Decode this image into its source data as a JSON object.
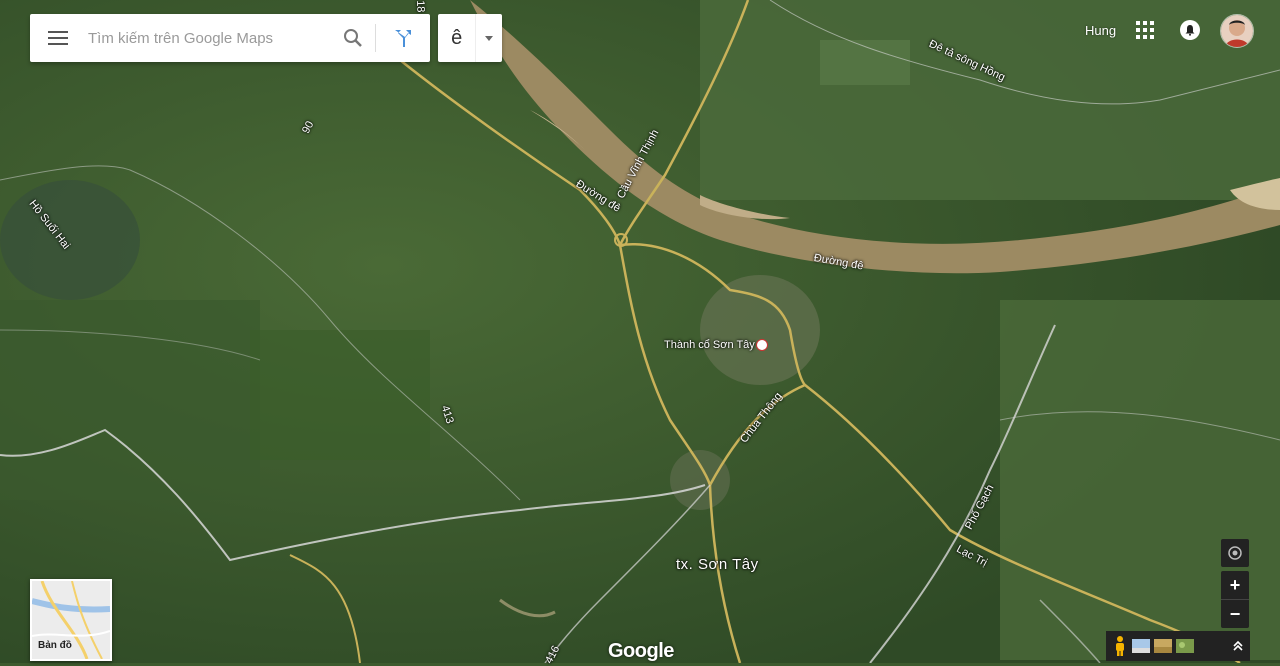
{
  "search": {
    "placeholder": "Tìm kiếm trên Google Maps"
  },
  "ime": {
    "char": "ê"
  },
  "user": {
    "name": "Hung"
  },
  "map": {
    "type": "satellite",
    "labels": {
      "city": "tx. Sơn Tây",
      "citadel": "Thành cổ Sơn Tây",
      "bridge": "Cầu Vĩnh Thịnh",
      "dike_road_1": "Đường đê",
      "dike_road_2": "Đường đê",
      "dike_red_river": "Đê tả sông Hồng",
      "lake": "Hồ Suối Hai",
      "chua_thong": "Chùa Thông",
      "pho_gach": "Phố Gạch",
      "lac_tri": "Lạc Trị",
      "route_90": "90",
      "route_413": "413",
      "route_416": "416",
      "route_18": "18"
    }
  },
  "minimap": {
    "label": "Bản đồ"
  },
  "footer": {
    "logo": "Google"
  },
  "controls": {
    "zoom_in": "+",
    "zoom_out": "−",
    "expand": "⌃"
  },
  "colors": {
    "road": "#c9b25a",
    "river": "#9c8a62",
    "road_white": "#d8d8d8"
  }
}
